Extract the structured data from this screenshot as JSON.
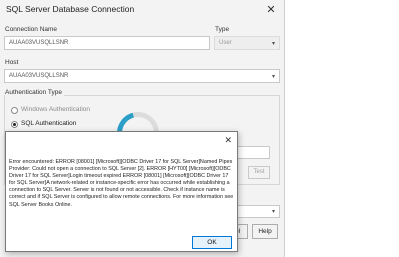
{
  "window": {
    "title": "SQL Server Database Connection",
    "close_glyph": "✕"
  },
  "form": {
    "connection_name_label": "Connection Name",
    "connection_name_value": "AUAA03VUSQLLSNR",
    "type_label": "Type",
    "type_value": "User",
    "host_label": "Host",
    "host_value": "AUAA03VUSQLLSNR",
    "dropdown_glyph": "▾",
    "auth_group_label": "Authentication Type",
    "auth_options": [
      {
        "label": "Windows Authentication",
        "selected": false
      },
      {
        "label": "SQL Authentication",
        "selected": true
      }
    ],
    "test_label": "Test"
  },
  "buttons": {
    "cancel_label": "cel",
    "help_label": "Help"
  },
  "error_dialog": {
    "close_glyph": "✕",
    "message": "Error encountered: ERROR [08001] [Microsoft][ODBC Driver 17 for SQL Server]Named Pipes Provider: Could not open a connection to SQL Server [2]. ERROR [HYT00] [Microsoft][ODBC Driver 17 for SQL Server]Login timeout expired ERROR [08001] [Microsoft][ODBC Driver 17 for SQL Server]A network-related or instance-specific error has occurred while establishing a connection to SQL Server. Server is not found or not accessible. Check if instance name is correct and if SQL Server is configured to allow remote connections. For more information see SQL Server Books Online.",
    "ok_label": "OK"
  },
  "colors": {
    "accent": "#0078d7",
    "spinner": "#2b9fc8"
  }
}
